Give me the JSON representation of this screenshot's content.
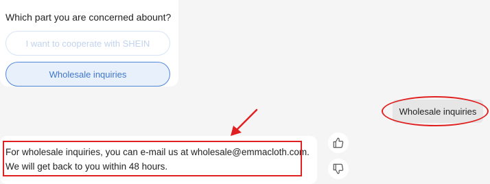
{
  "bot_message": {
    "question": "Which part you are concerned abount?",
    "options": [
      {
        "label": "I want to cooperate with SHEIN",
        "state": "disabled"
      },
      {
        "label": "Wholesale inquiries",
        "state": "selected"
      }
    ]
  },
  "user_message": {
    "text": "Wholesale inquiries"
  },
  "bot_answer": {
    "line1": "For wholesale inquiries, you can e-mail us at wholesale@emmacloth.com.",
    "line2": "We will get back to you within 48 hours."
  },
  "feedback": {
    "like_icon": "thumbs-up-icon",
    "dislike_icon": "thumbs-down-icon"
  },
  "annotations": {
    "color": "#e02020",
    "arrow_icon": "red-arrow-icon"
  },
  "colors": {
    "accent": "#4f86d9",
    "background": "#f5f5f5"
  }
}
